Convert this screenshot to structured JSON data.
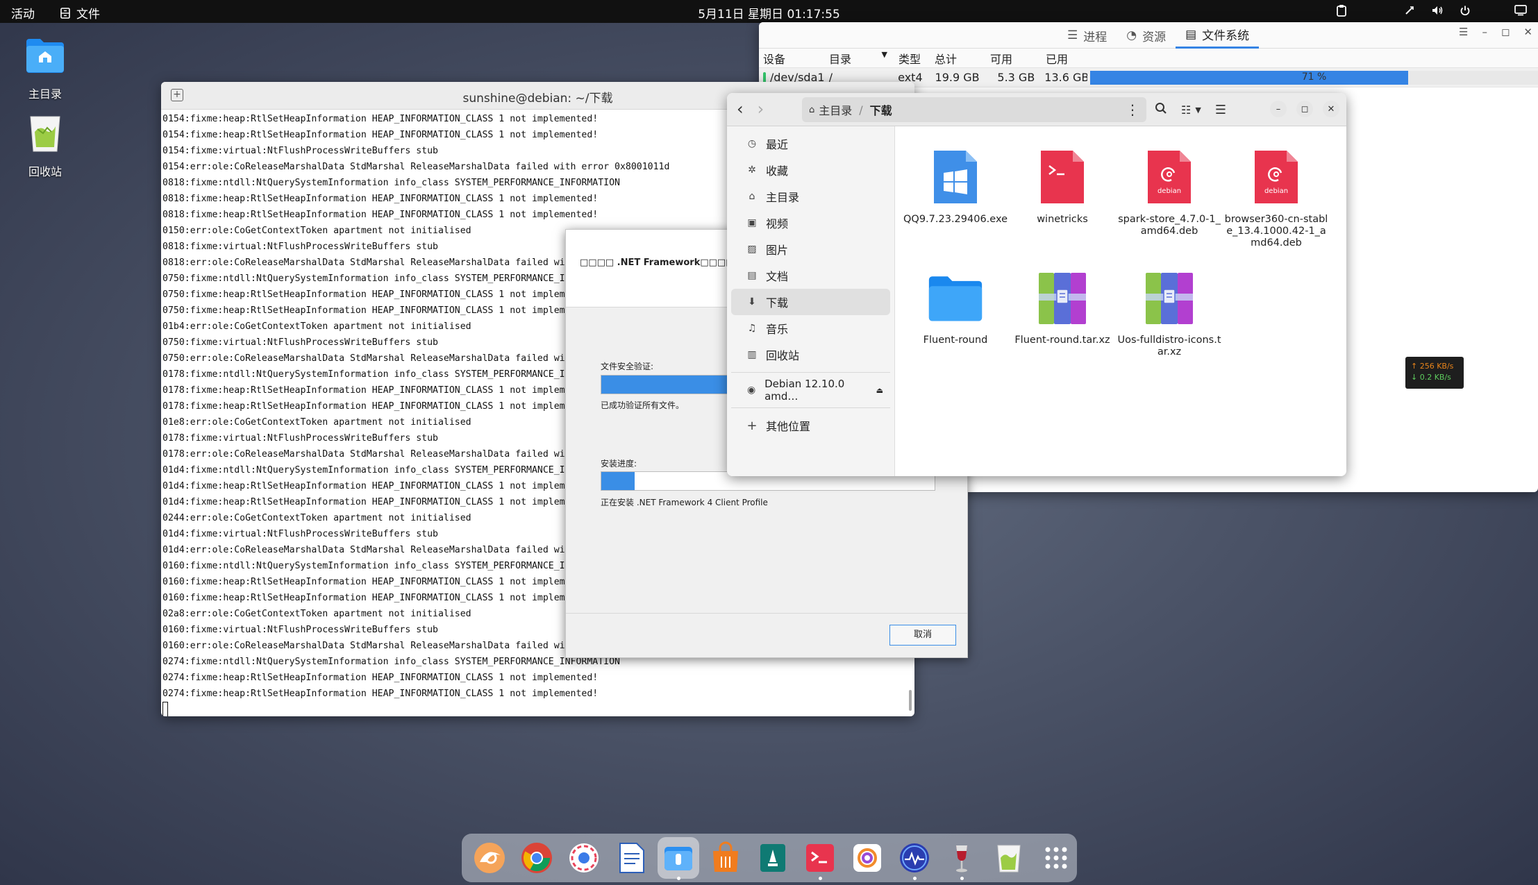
{
  "topbar": {
    "activities": "活动",
    "app_menu": "文件",
    "clock": "5月11日 星期日  01:17:55"
  },
  "desktop": {
    "home_label": "主目录",
    "trash_label": "回收站"
  },
  "sysmon": {
    "tabs": [
      "进程",
      "资源",
      "文件系统"
    ],
    "active_tab": "文件系统",
    "columns": [
      "设备",
      "目录",
      "类型",
      "总计",
      "可用",
      "已用"
    ],
    "row": {
      "device": "/dev/sda1",
      "dir": "/",
      "type": "ext4",
      "total": "19.9 GB",
      "free": "5.3 GB",
      "used": "13.6 GB",
      "percent_label": "71 %",
      "percent": 71
    }
  },
  "terminal": {
    "title": "sunshine@debian: ~/下载",
    "lines": [
      "0154:fixme:heap:RtlSetHeapInformation HEAP_INFORMATION_CLASS 1 not implemented!",
      "0154:fixme:heap:RtlSetHeapInformation HEAP_INFORMATION_CLASS 1 not implemented!",
      "0154:fixme:virtual:NtFlushProcessWriteBuffers stub",
      "0154:err:ole:CoReleaseMarshalData StdMarshal ReleaseMarshalData failed with error 0x8001011d",
      "0818:fixme:ntdll:NtQuerySystemInformation info_class SYSTEM_PERFORMANCE_INFORMATION",
      "0818:fixme:heap:RtlSetHeapInformation HEAP_INFORMATION_CLASS 1 not implemented!",
      "0818:fixme:heap:RtlSetHeapInformation HEAP_INFORMATION_CLASS 1 not implemented!",
      "0150:err:ole:CoGetContextToken apartment not initialised",
      "0818:fixme:virtual:NtFlushProcessWriteBuffers stub",
      "0818:err:ole:CoReleaseMarshalData StdMarshal ReleaseMarshalData failed with error 0",
      "0750:fixme:ntdll:NtQuerySystemInformation info_class SYSTEM_PERFORMANCE_INFORMATION",
      "0750:fixme:heap:RtlSetHeapInformation HEAP_INFORMATION_CLASS 1 not implemented!",
      "0750:fixme:heap:RtlSetHeapInformation HEAP_INFORMATION_CLASS 1 not implemented!",
      "01b4:err:ole:CoGetContextToken apartment not initialised",
      "0750:fixme:virtual:NtFlushProcessWriteBuffers stub",
      "0750:err:ole:CoReleaseMarshalData StdMarshal ReleaseMarshalData failed with error 0",
      "0178:fixme:ntdll:NtQuerySystemInformation info_class SYSTEM_PERFORMANCE_INFORMATION",
      "0178:fixme:heap:RtlSetHeapInformation HEAP_INFORMATION_CLASS 1 not implemented!",
      "0178:fixme:heap:RtlSetHeapInformation HEAP_INFORMATION_CLASS 1 not implemented!",
      "01e8:err:ole:CoGetContextToken apartment not initialised",
      "0178:fixme:virtual:NtFlushProcessWriteBuffers stub",
      "0178:err:ole:CoReleaseMarshalData StdMarshal ReleaseMarshalData failed with error 0",
      "01d4:fixme:ntdll:NtQuerySystemInformation info_class SYSTEM_PERFORMANCE_INFORMATION",
      "01d4:fixme:heap:RtlSetHeapInformation HEAP_INFORMATION_CLASS 1 not implemented!",
      "01d4:fixme:heap:RtlSetHeapInformation HEAP_INFORMATION_CLASS 1 not implemented!",
      "0244:err:ole:CoGetContextToken apartment not initialised",
      "01d4:fixme:virtual:NtFlushProcessWriteBuffers stub",
      "01d4:err:ole:CoReleaseMarshalData StdMarshal ReleaseMarshalData failed with error 0",
      "0160:fixme:ntdll:NtQuerySystemInformation info_class SYSTEM_PERFORMANCE_INFORMATION",
      "0160:fixme:heap:RtlSetHeapInformation HEAP_INFORMATION_CLASS 1 not implemented!",
      "0160:fixme:heap:RtlSetHeapInformation HEAP_INFORMATION_CLASS 1 not implemented!",
      "02a8:err:ole:CoGetContextToken apartment not initialised",
      "0160:fixme:virtual:NtFlushProcessWriteBuffers stub",
      "0160:err:ole:CoReleaseMarshalData StdMarshal ReleaseMarshalData failed with error 0",
      "0274:fixme:ntdll:NtQuerySystemInformation info_class SYSTEM_PERFORMANCE_INFORMATION",
      "0274:fixme:heap:RtlSetHeapInformation HEAP_INFORMATION_CLASS 1 not implemented!",
      "0274:fixme:heap:RtlSetHeapInformation HEAP_INFORMATION_CLASS 1 not implemented!"
    ]
  },
  "installer": {
    "title": "□□□□ .NET Framework□□□□□",
    "verify_label": "文件安全验证:",
    "verify_status": "已成功验证所有文件。",
    "verify_progress": 100,
    "install_label": "安装进度:",
    "install_status": "正在安装 .NET Framework 4 Client Profile",
    "install_progress": 10,
    "cancel": "取消"
  },
  "files": {
    "path_home": "主目录",
    "path_current": "下载",
    "sidebar": [
      {
        "icon": "clock-icon",
        "label": "最近"
      },
      {
        "icon": "star-icon",
        "label": "收藏"
      },
      {
        "icon": "home-icon",
        "label": "主目录"
      },
      {
        "icon": "video-icon",
        "label": "视频"
      },
      {
        "icon": "picture-icon",
        "label": "图片"
      },
      {
        "icon": "document-icon",
        "label": "文档"
      },
      {
        "icon": "download-icon",
        "label": "下载"
      },
      {
        "icon": "music-icon",
        "label": "音乐"
      },
      {
        "icon": "trash-icon",
        "label": "回收站"
      }
    ],
    "drive": "Debian 12.10.0 amd…",
    "other_locations": "其他位置",
    "items": [
      {
        "name": "QQ9.7.23.29406.exe",
        "icon": "windows-exe-icon"
      },
      {
        "name": "winetricks",
        "icon": "script-icon"
      },
      {
        "name": "spark-store_4.7.0-1_amd64.deb",
        "icon": "debian-package-icon"
      },
      {
        "name": "browser360-cn-stable_13.4.1000.42-1_amd64.deb",
        "icon": "debian-package-icon"
      },
      {
        "name": "Fluent-round",
        "icon": "folder-icon"
      },
      {
        "name": "Fluent-round.tar.xz",
        "icon": "archive-icon"
      },
      {
        "name": "Uos-fulldistro-icons.tar.xz",
        "icon": "archive-icon"
      }
    ],
    "debian_badge": "debian"
  },
  "netspeed": {
    "up": "↑ 256 KB/s",
    "down": "↓ 0.2 KB/s"
  },
  "dock": {
    "apps": [
      "deepin-icon",
      "chrome-icon",
      "screenshot-icon",
      "text-editor-icon",
      "files-icon",
      "app-store-icon",
      "package-icon",
      "terminal-icon",
      "image-viewer-icon",
      "system-monitor-icon",
      "wine-icon",
      "trash-icon",
      "app-grid-icon"
    ]
  },
  "colors": {
    "accent": "#3584e4",
    "debian_red": "#e8344e",
    "installer_blue": "#3a8ee6"
  }
}
